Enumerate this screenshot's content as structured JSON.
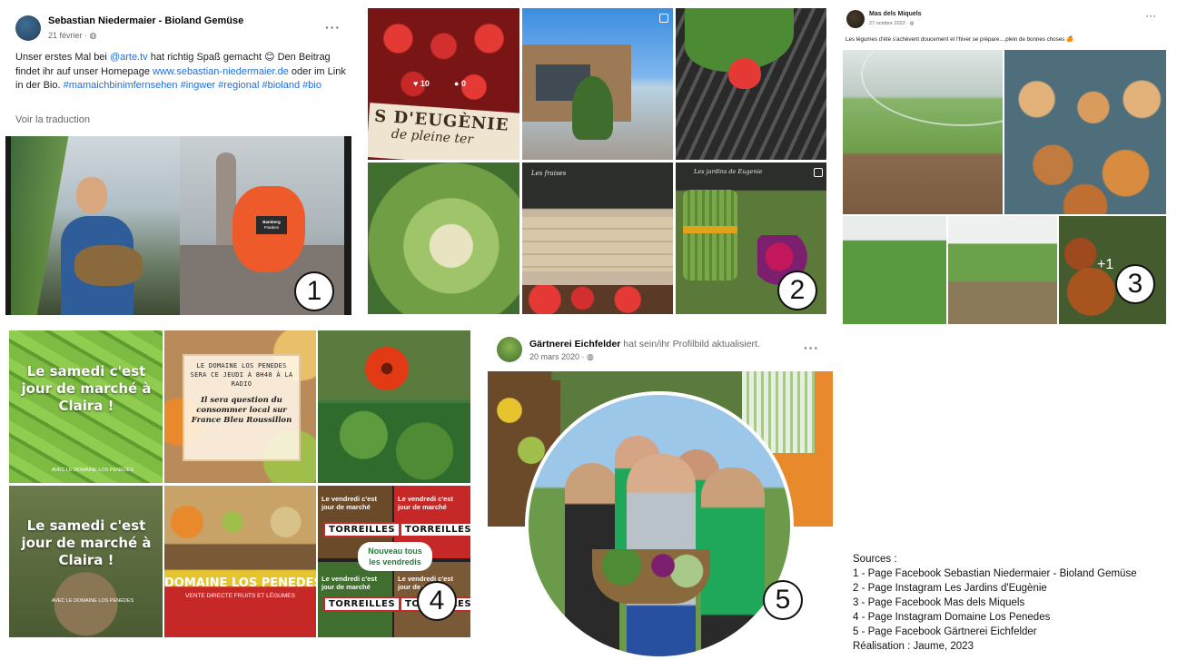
{
  "post1": {
    "author": "Sebastian Niedermaier - Bioland Gemüse",
    "date": "21 février · ",
    "text_part1": "Unser erstes Mal bei ",
    "mention": "@arte.tv",
    "text_part2": " hat richtig Spaß gemacht 😊 Den Beitrag findet ihr auf unser Homepage ",
    "website": "www.sebastian-niedermaier.de",
    "text_part3": " oder im Link in der Bio. ",
    "hashtags": "#mamaichbinimfernsehen #ingwer #regional #bioland #bio",
    "translate": "Voir la traduction",
    "video_label_top": "Bamberg",
    "video_label_bottom": "Franken",
    "badge": "1"
  },
  "post2": {
    "likes": "10",
    "comments": "0",
    "sign_line1": "S D'EUGÈNIE",
    "sign_line2": "de pleine ter",
    "board_text1": "Les fraises",
    "board_text2": "Les jardins de Eugenie",
    "badge": "2"
  },
  "post3": {
    "author": "Mas dels Miquels",
    "date": "27 octobre 2022 · ",
    "text": "Les légumes d'été s'achèvent doucement et l'hiver se prépare....plein de bonnes choses 🍊",
    "more_count": "+1",
    "badge": "3"
  },
  "post4": {
    "tile1_text": "Le samedi c'est jour de marché à Claira !",
    "tile1_sub": "AVEC LE DOMAINE LOS PENEDES",
    "tile2_heading": "LE DOMAINE LOS PENEDES SERA CE JEUDI À 8H40 À LA RADIO",
    "tile2_body": "Il sera question du consommer local sur France Bleu Roussillon",
    "tile4_text": "Le samedi c'est jour de marché à Claira !",
    "tile4_sub": "AVEC LE DOMAINE LOS PENEDES",
    "banner_line1": "DOMAINE LOS PENEDES",
    "banner_line2": "VENTE DIRECTE FRUITS ET LÉGUMES",
    "mini_title": "Le vendredi c'est jour de marché",
    "mini_tag": "TORREILLES",
    "bubble_line1": "Nouveau tous",
    "bubble_line2": "les vendredis",
    "badge": "4"
  },
  "post5": {
    "author": "Gärtnerei Eichfelder",
    "action": " hat sein/ihr Profilbild aktualisiert.",
    "date": "20 mars 2020 · ",
    "badge": "5"
  },
  "sources": {
    "heading": "Sources :",
    "lines": [
      "1 - Page Facebook Sebastian Niedermaier - Bioland Gemüse",
      "2 - Page Instagram Les Jardins d'Eugènie",
      "3 - Page Facebook Mas dels Miquels",
      "4 - Page Instagram Domaine Los Penedes",
      "5 - Page Facebook Gärtnerei Eichfelder"
    ],
    "credit": "Réalisation : Jaume, 2023"
  },
  "colors": {
    "link": "#216fdb",
    "brand_green": "#1fa85a",
    "tag_red": "#c62828"
  },
  "icons": [
    "more-options-icon",
    "globe-icon",
    "heart-icon",
    "comment-icon",
    "multi-photo-icon"
  ]
}
